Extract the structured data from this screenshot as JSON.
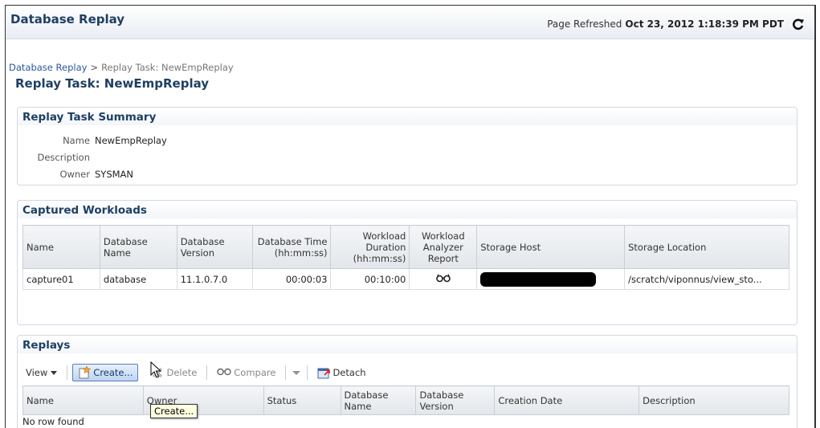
{
  "header": {
    "title": "Database Replay",
    "refresh_label": "Page Refreshed",
    "refresh_time": "Oct 23, 2012 1:18:39 PM PDT"
  },
  "breadcrumb": {
    "root": "Database Replay",
    "separator": ">",
    "current": "Replay Task: NewEmpReplay"
  },
  "page_title": "Replay Task: NewEmpReplay",
  "summary": {
    "title": "Replay Task Summary",
    "name_label": "Name",
    "name_value": "NewEmpReplay",
    "description_label": "Description",
    "description_value": "",
    "owner_label": "Owner",
    "owner_value": "SYSMAN"
  },
  "captured": {
    "title": "Captured Workloads",
    "columns": [
      "Name",
      "Database Name",
      "Database Version",
      "Database Time (hh:mm:ss)",
      "Workload Duration (hh:mm:ss)",
      "Workload Analyzer Report",
      "Storage Host",
      "Storage Location"
    ],
    "rows": [
      {
        "name": "capture01",
        "db_name": "database",
        "db_version": "11.1.0.7.0",
        "db_time": "00:00:03",
        "duration": "00:10:00",
        "report_icon": "glasses-icon",
        "storage_host": "",
        "storage_location": "/scratch/viponnus/view_sto..."
      }
    ]
  },
  "replays": {
    "title": "Replays",
    "toolbar": {
      "view_label": "View",
      "create_label": "Create...",
      "delete_label": "Delete",
      "compare_label": "Compare",
      "detach_label": "Detach"
    },
    "columns": [
      "Name",
      "Owner",
      "Status",
      "Database Name",
      "Database Version",
      "Creation Date",
      "Description"
    ],
    "empty_text": "No row found",
    "tooltip": "Create..."
  },
  "colors": {
    "title_blue": "#1f3f63",
    "link_blue": "#2a57a0",
    "create_button_border": "#4d7fc7"
  }
}
